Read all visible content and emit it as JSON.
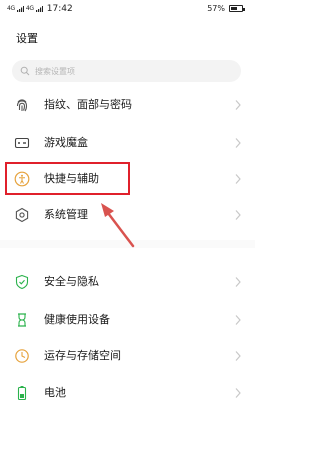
{
  "status_bar": {
    "signal1": "4G",
    "signal2": "4G",
    "time": "17:42",
    "battery_percent_text": "57%",
    "battery_level": 0.57
  },
  "page_title": "设置",
  "search": {
    "placeholder": "搜索设置项"
  },
  "items": [
    {
      "label": "指纹、面部与密码",
      "icon": "fingerprint-icon",
      "color": "#555555"
    },
    {
      "label": "游戏魔盒",
      "icon": "game-box-icon",
      "color": "#444444"
    },
    {
      "label": "快捷与辅助",
      "icon": "shortcut-assist-icon",
      "color": "#e6a23c"
    },
    {
      "label": "系统管理",
      "icon": "system-manage-icon",
      "color": "#555555"
    },
    {
      "label": "安全与隐私",
      "icon": "shield-icon",
      "color": "#2bb24c"
    },
    {
      "label": "健康使用设备",
      "icon": "hourglass-icon",
      "color": "#2bb24c"
    },
    {
      "label": "运存与存储空间",
      "icon": "storage-clock-icon",
      "color": "#e6a23c"
    },
    {
      "label": "电池",
      "icon": "battery-icon",
      "color": "#2bb24c"
    }
  ],
  "colors": {
    "highlight": "#e0202b",
    "arrow": "#d9534f",
    "chevron": "#c8c8c8"
  }
}
